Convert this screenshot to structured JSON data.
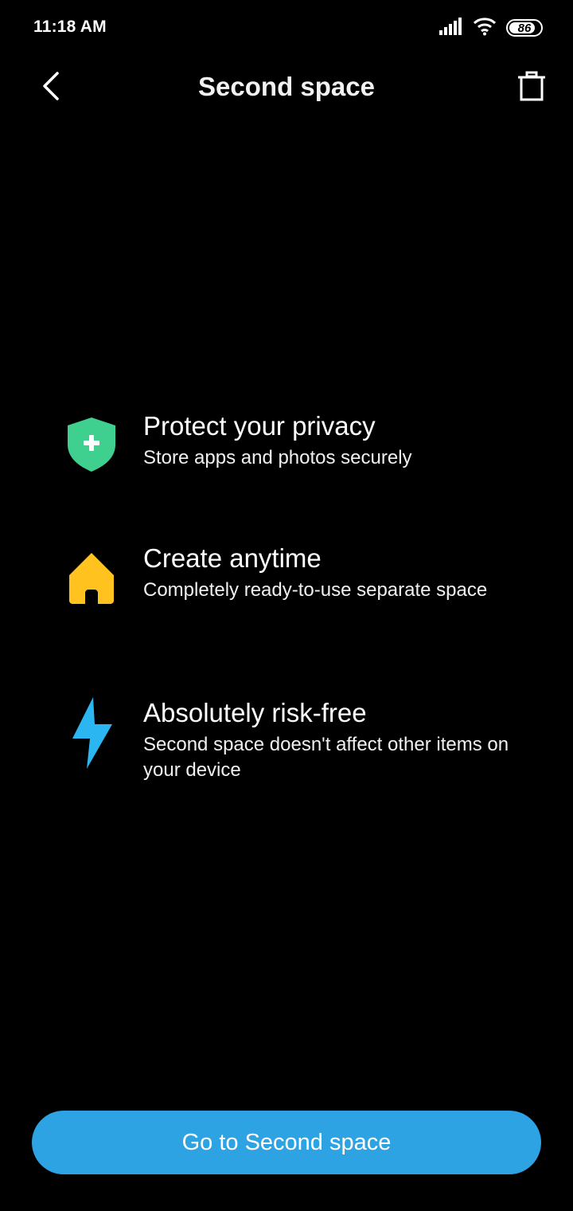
{
  "status_bar": {
    "time": "11:18 AM",
    "battery_level": "86",
    "battery_fraction": 0.86,
    "icons": [
      "signal-icon",
      "wifi-icon",
      "battery-icon"
    ]
  },
  "header": {
    "title": "Second space",
    "back_icon": "chevron-left-icon",
    "delete_icon": "trash-icon"
  },
  "features": [
    {
      "icon": "shield-plus-icon",
      "icon_color": "#3fcf8e",
      "title": "Protect your privacy",
      "description": "Store apps and photos securely"
    },
    {
      "icon": "home-icon",
      "icon_color": "#ffc21f",
      "title": "Create anytime",
      "description": "Completely ready-to-use separate space"
    },
    {
      "icon": "lightning-icon",
      "icon_color": "#2bb6f2",
      "title": "Absolutely risk-free",
      "description": "Second space doesn't affect other items on your device"
    }
  ],
  "primary_button": {
    "label": "Go to Second space",
    "color": "#2ea3e3"
  },
  "colors": {
    "background": "#000000",
    "text": "#ffffff"
  }
}
